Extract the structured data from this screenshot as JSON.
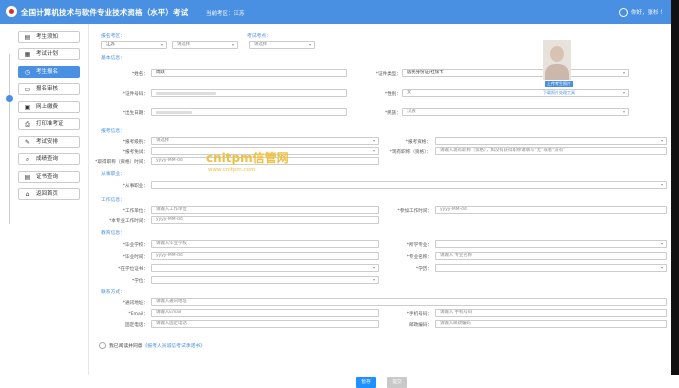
{
  "header": {
    "title": "全国计算机技术与软件专业技术资格（水平）考试",
    "region": "当前考区：江苏",
    "user": "你好，张杉 ！"
  },
  "sidebar": {
    "items": [
      {
        "label": "考生须知",
        "icon": "book-icon"
      },
      {
        "label": "考试计划",
        "icon": "calendar-icon"
      },
      {
        "label": "考生报名",
        "icon": "clock-icon"
      },
      {
        "label": "报名审核",
        "icon": "document-icon"
      },
      {
        "label": "网上缴费",
        "icon": "monitor-icon"
      },
      {
        "label": "打印准考证",
        "icon": "printer-icon"
      },
      {
        "label": "考试安排",
        "icon": "edit-icon"
      },
      {
        "label": "成绩查询",
        "icon": "search-icon"
      },
      {
        "label": "证书查询",
        "icon": "certificate-icon"
      },
      {
        "label": "返回首页",
        "icon": "home-icon"
      }
    ],
    "active_index": 2
  },
  "exam": {
    "region_label": "报名考区：",
    "region_value": "江苏",
    "region_sub": "请选择",
    "site_label": "考试考点：",
    "site_value": "请选择"
  },
  "basic": {
    "title": "基本信息：",
    "name_label": "*姓名：",
    "name_value": "周跃",
    "idtype_label": "*证件类型：",
    "idtype_value": "居民身份证/社保卡",
    "idno_label": "*证件号码：",
    "gender_label": "*性别：",
    "gender_value": "女",
    "birth_label": "*出生日期：",
    "nation_label": "*民族：",
    "nation_value": "汉族",
    "upload_btn": "上传考生照片",
    "photo_tool_link": "下载照片处理工具"
  },
  "apply": {
    "title": "报考信息：",
    "level_label": "*报考级别：",
    "level_value": "请选择",
    "subject_label": "*报考资格：",
    "subject_value": "",
    "exempt_label": "*报考免试：",
    "exempt_value": "",
    "title_label": "*现有职称（资格）：",
    "title_placeholder": "请输入现有职称（资格），如没有获得职称请填写“无”或者“没有”",
    "date_label": "*取得职称（资格）时间：",
    "date_placeholder": "yyyy-MM-dd"
  },
  "work_type": {
    "title": "从事职业：",
    "label": "*从事职业：",
    "value": ""
  },
  "work": {
    "title": "工作信息：",
    "unit_label": "*工作单位：",
    "unit_placeholder": "请输入工作单位",
    "start_label": "*参加工作时间：",
    "start_placeholder": "yyyy-MM-dd",
    "years_label": "*本专业工作时间：",
    "years_placeholder": "yyyy-MM-dd"
  },
  "edu": {
    "title": "教育信息：",
    "school_label": "*毕业学校：",
    "school_placeholder": "请输入毕业学校",
    "major_label": "*所学专业：",
    "major_value": "",
    "grad_label": "*毕业时间：",
    "grad_placeholder": "yyyy-MM-dd",
    "edu_name_label": "*专业名称：",
    "edu_name_placeholder": "请输入 专业名称",
    "degree_cat_label": "*在学位证书：",
    "degree_cat_value": "",
    "xueli_label": "*学历：",
    "xueli_value": "",
    "xuewei_label": "*学位：",
    "xuewei_value": ""
  },
  "contact": {
    "title": "联系方式：",
    "addr_label": "*通讯地址：",
    "addr_placeholder": "请输入通讯地址",
    "email_label": "*Email：",
    "email_placeholder": "请输入Email",
    "phone_label": "*手机号码：",
    "phone_placeholder": "请输入 手机号码",
    "tel_label": "固定电话：",
    "tel_placeholder": "请输入固定电话",
    "zip_label": "邮政编码：",
    "zip_placeholder": "请输入邮政编码"
  },
  "footer": {
    "agree_text": "我已阅读并同意",
    "agree_link": "《报考人员诚信考试承诺书》",
    "save_label": "暂存",
    "next_label": "提交"
  },
  "watermark": {
    "main": "cnitpm信管网",
    "url": "www.cnitpm.com"
  }
}
